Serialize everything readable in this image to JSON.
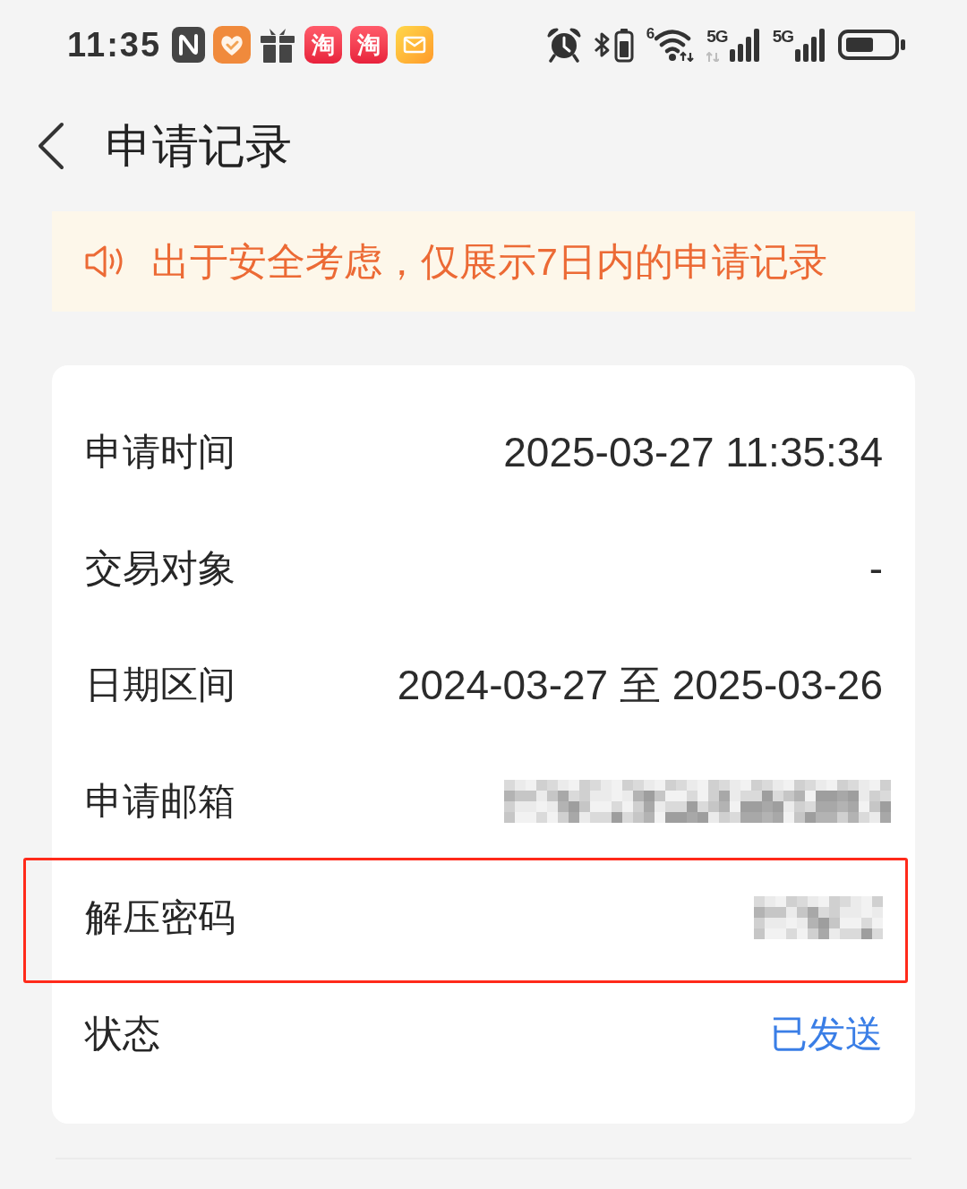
{
  "status_bar": {
    "time": "11:35",
    "app_badges": [
      {
        "label": "淘"
      },
      {
        "label": "淘"
      }
    ],
    "wifi_standard": "6",
    "networks": [
      {
        "label": "5G",
        "data_active": true
      },
      {
        "label": "5G",
        "data_active": false
      }
    ]
  },
  "header": {
    "title": "申请记录"
  },
  "notice": {
    "text": "出于安全考虑，仅展示7日内的申请记录"
  },
  "card": {
    "rows": [
      {
        "label": "申请时间",
        "kind": "text",
        "value": "2025-03-27 11:35:34",
        "highlighted": false
      },
      {
        "label": "交易对象",
        "kind": "text",
        "value": "-",
        "highlighted": false
      },
      {
        "label": "日期区间",
        "kind": "text",
        "value": "2024-03-27 至 2025-03-26",
        "highlighted": false
      },
      {
        "label": "申请邮箱",
        "kind": "email",
        "highlighted": false
      },
      {
        "label": "解压密码",
        "kind": "password",
        "highlighted": true
      },
      {
        "label": "状态",
        "kind": "status",
        "value": "已发送",
        "highlighted": false
      }
    ]
  }
}
